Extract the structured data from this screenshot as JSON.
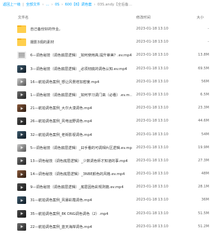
{
  "breadcrumb": {
    "back": "返回上一级",
    "all": "全部文件",
    "items": [
      "…",
      "0S",
      "600【8】调色套",
      "03S.andy【全后备…"
    ]
  },
  "header": {
    "name": "文件名",
    "date": "修改时间",
    "size": "大小"
  },
  "files": [
    {
      "kind": "folder",
      "name": "自己备份好的作业。",
      "date": "2023-01-18 13:10",
      "size": "-"
    },
    {
      "kind": "folder",
      "name": "摄影3观的素材",
      "date": "2023-01-18 13:10",
      "size": "-"
    },
    {
      "kind": "doc",
      "name": "6—调色秘技（调色底层逻辑）_如何使用高,提升审美？.ev.mp4",
      "date": "2023-01-18 13:10",
      "size": "13.8M"
    },
    {
      "kind": "video",
      "name": "3—调色秘技（调色底层逻辑）_必须彻底的调色认知.ev.mp4",
      "date": "2023-01-18 13:10",
      "size": "69.5M"
    },
    {
      "kind": "video",
      "name": "16—航拍调色案例_想让风景增加密度.mp4",
      "date": "2023-01-18 13:10",
      "size": "56M"
    },
    {
      "kind": "video",
      "name": "1—调色秘技（调色底层逻辑）_如何学习调门高（必看）.ev.m…",
      "date": "2023-01-18 13:10",
      "size": "6.5M"
    },
    {
      "kind": "video",
      "name": "21—航拍调色案例_大尔大漠调色.mp4",
      "date": "2023-01-18 13:10",
      "size": "23.3M"
    },
    {
      "kind": "video",
      "name": "26—航拍调色案例_风电运野调色.mp4",
      "date": "2023-01-18 13:10",
      "size": "44.6M"
    },
    {
      "kind": "video",
      "name": "32—航拍调色案例_老街影视调色.mp4",
      "date": "2023-01-18 13:10",
      "size": "54M"
    },
    {
      "kind": "video",
      "name": "5—调色秘技（调色底层逻辑）_曰手看的可调相片区逻辑.ev.mp4",
      "date": "2023-01-18 13:10",
      "size": "19.9M"
    },
    {
      "kind": "video",
      "name": "13—调色秘技（调色底层逻辑）_少数调色师才知道的事.mp4",
      "date": "2023-01-18 13:10",
      "size": "27.3M"
    },
    {
      "kind": "video",
      "name": "14—调色秘技（调色底层逻辑）_3NBE颜色的风格.ev.mp4",
      "date": "2023-01-18 13:10",
      "size": "48M"
    },
    {
      "kind": "video",
      "name": "9—调色秘技（调色底层逻辑）_底层因色彩规则篇.ev.mp4",
      "date": "2023-01-18 13:10",
      "size": "28.1M"
    },
    {
      "kind": "video",
      "name": "31—航拍调色案例_风暴彩霞调色.mp4",
      "date": "2023-01-18 13:10",
      "size": "36M"
    },
    {
      "kind": "video",
      "name": "35—航拍调色案例_8K DNG调色调色（2）.mp4",
      "date": "2023-01-18 13:10",
      "size": "51.5M"
    },
    {
      "kind": "video",
      "name": "22—航拍调色案例_蓝天海岸调色.mp4",
      "date": "2023-01-18 13:10",
      "size": "51.2M"
    }
  ]
}
